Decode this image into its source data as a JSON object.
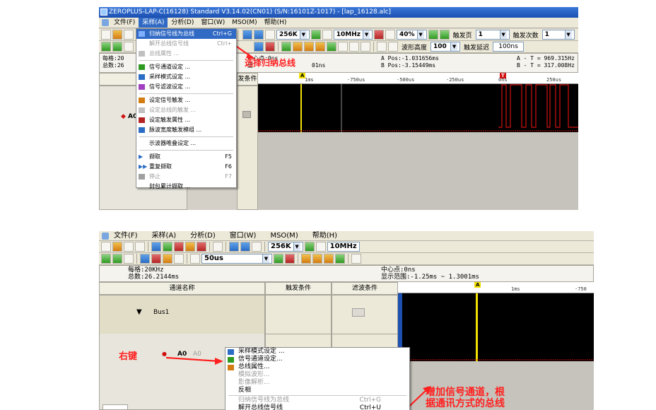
{
  "shot1": {
    "title": "ZEROPLUS-LAP-C(16128) Standard V3.14.02(CN01) (S/N:16101Z-1017) - [lap_16128.alc]",
    "menu": [
      "文件(F)",
      "采样(A)",
      "分析(D)",
      "窗口(W)",
      "MSO(M)",
      "帮助(H)"
    ],
    "toolbar": {
      "depth": "256K",
      "freq": "10MHz",
      "percent": "40%",
      "trigger_page_label": "触发页",
      "trigger_page": "1",
      "trigger_count_label": "触发次数",
      "trigger_count": "1",
      "wave_height_label": "波形高度",
      "wave_height": "100",
      "trigger_delay_label": "触发延迟",
      "trigger_delay": "100ns"
    },
    "info": {
      "per_div": "每格:20",
      "total": "总数:26",
      "center": "中心点:0ns",
      "range": "显",
      "range_tail": "01ns",
      "apos": "A Pos:-1.031656ms",
      "bpos": "B Pos:-3.15449ms",
      "at": "A - T = 969.315Hz",
      "bt": "B - T = 317.008Hz"
    },
    "channel_header": "通",
    "trigger_header": "发条件",
    "channel_a0": "A0",
    "ruler_ticks": [
      "1ms",
      "-750us",
      "-500us",
      "-250us",
      "0ns",
      "250us"
    ],
    "marker_a": "A",
    "marker_t": "T",
    "menu_items": [
      {
        "label": "归纳信号线为总线",
        "shortcut": "Ctrl+G",
        "state": "highlight"
      },
      {
        "label": "解开总线信号线",
        "shortcut": "Ctrl+",
        "state": "disabled"
      },
      {
        "label": "总线属性 ...",
        "shortcut": "",
        "state": "disabled"
      },
      {
        "label": "信号通道设定 ...",
        "shortcut": "",
        "state": "normal"
      },
      {
        "label": "采样模式设定 ...",
        "shortcut": "",
        "state": "normal"
      },
      {
        "label": "信号滤波设定 ...",
        "shortcut": "",
        "state": "normal"
      },
      {
        "label": "设定信号触发 ...",
        "shortcut": "",
        "state": "normal"
      },
      {
        "label": "设定总线的触发 ...",
        "shortcut": "",
        "state": "disabled"
      },
      {
        "label": "设定触发属性 ...",
        "shortcut": "",
        "state": "normal"
      },
      {
        "label": "脉波宽度触发模组 ...",
        "shortcut": "",
        "state": "normal"
      },
      {
        "label": "示波器唯叠设定 ...",
        "shortcut": "",
        "state": "normal"
      },
      {
        "label": "撷取",
        "shortcut": "F5",
        "state": "normal"
      },
      {
        "label": "重复撷取",
        "shortcut": "F6",
        "state": "normal"
      },
      {
        "label": "停止",
        "shortcut": "F7",
        "state": "disabled"
      },
      {
        "label": "封包累计撷取 ...",
        "shortcut": "",
        "state": "normal"
      }
    ],
    "annotation": "选择归纳总线"
  },
  "shot2": {
    "menu": [
      "文件(F)",
      "采样(A)",
      "分析(D)",
      "窗口(W)",
      "MSO(M)",
      "帮助(H)"
    ],
    "toolbar": {
      "depth": "256K",
      "freq": "10MHz",
      "timebase": "50us"
    },
    "info": {
      "per_div": "每格:20KHz",
      "total": "总数:26.2144ms",
      "center": "中心点:0ns",
      "range": "显示范围:-1.25ms ~ 1.3001ms"
    },
    "headers": {
      "channel": "通道名称",
      "trigger": "触发条件",
      "filter": "滤波条件"
    },
    "bus_name": "Bus1",
    "channel_a0": "A0",
    "channel_a0_dim": "A0",
    "ruler_ticks": [
      "1ms",
      "-750"
    ],
    "marker_a": "A",
    "right_click_label": "右键",
    "menu_items": [
      {
        "label": "采样模式设定 ...",
        "shortcut": "",
        "state": "normal"
      },
      {
        "label": "信号通道设定...",
        "shortcut": "",
        "state": "normal"
      },
      {
        "label": "总线属性...",
        "shortcut": "",
        "state": "normal"
      },
      {
        "label": "模拟波形...",
        "shortcut": "",
        "state": "disabled"
      },
      {
        "label": "影像解析...",
        "shortcut": "",
        "state": "disabled"
      },
      {
        "label": "反相",
        "shortcut": "",
        "state": "normal"
      },
      {
        "label": "归纳信号线为总线",
        "shortcut": "Ctrl+G",
        "state": "disabled"
      },
      {
        "label": "解开总线信号线",
        "shortcut": "Ctrl+U",
        "state": "normal"
      }
    ],
    "annotation_line1": "增加信号通道，根",
    "annotation_line2": "据通讯方式的总线"
  }
}
